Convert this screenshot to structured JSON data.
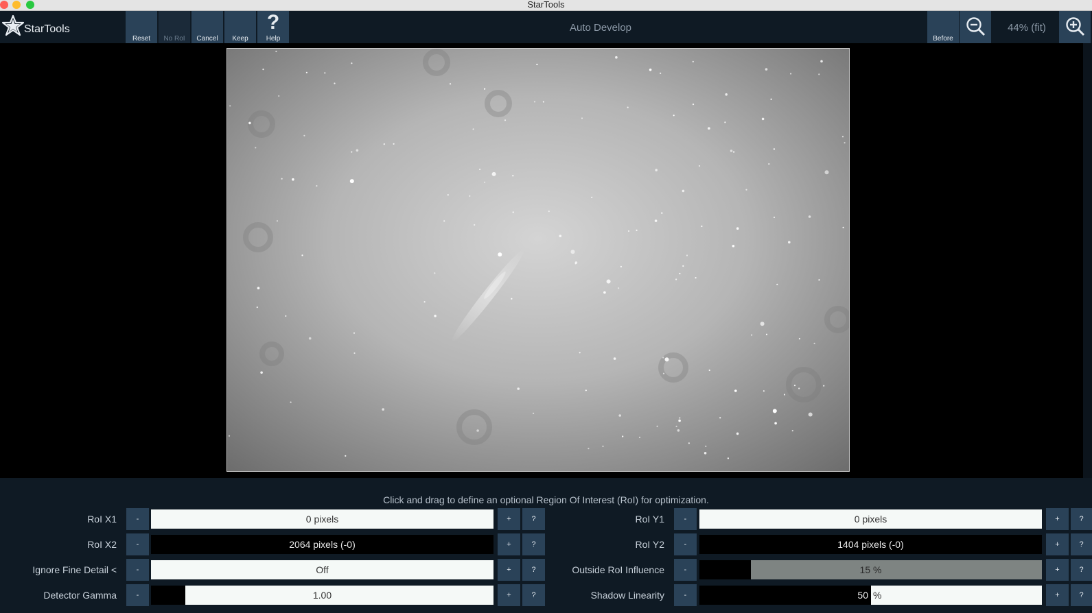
{
  "window": {
    "title": "StarTools"
  },
  "app": {
    "name": "StarTools"
  },
  "toolbar": {
    "reset_label": "Reset",
    "noroi_label": "No RoI",
    "cancel_label": "Cancel",
    "keep_label": "Keep",
    "help_label": "Help",
    "help_glyph": "?",
    "module_title": "Auto Develop",
    "before_label": "Before",
    "zoom_level": "44% (fit)"
  },
  "panel": {
    "hint": "Click and drag to define an optional Region Of Interest (RoI) for optimization.",
    "minus": "-",
    "plus": "+",
    "help": "?",
    "params": {
      "roi_x1": {
        "label": "RoI X1",
        "value": "0 pixels",
        "fill": 0
      },
      "roi_x2": {
        "label": "RoI X2",
        "value": "2064 pixels (-0)",
        "fill": 1.0
      },
      "ignore_fine": {
        "label": "Ignore Fine Detail <",
        "value": "Off",
        "fill": 0
      },
      "detector_gamma": {
        "label": "Detector Gamma",
        "value": "1.00",
        "fill": 0.1
      },
      "roi_y1": {
        "label": "RoI Y1",
        "value": "0 pixels",
        "fill": 0
      },
      "roi_y2": {
        "label": "RoI Y2",
        "value": "1404 pixels (-0)",
        "fill": 1.0
      },
      "outside_influence": {
        "label": "Outside RoI Influence",
        "value": "15 %",
        "fill": 0.15
      },
      "shadow_linearity": {
        "label": "Shadow Linearity",
        "value_left": "50",
        "value_right": "%",
        "fill": 0.5
      }
    }
  },
  "colors": {
    "panel_bg": "#0f1a24",
    "button_bg": "#2a4258",
    "bar_bg": "#f5f9f7"
  }
}
